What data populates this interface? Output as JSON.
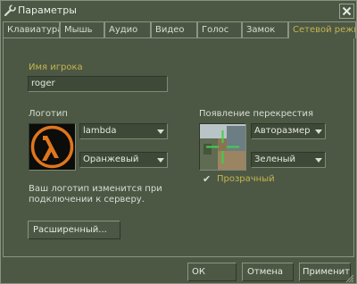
{
  "window": {
    "title": "Параметры",
    "close_glyph": "✕"
  },
  "tabs": [
    {
      "label": "Клавиатура",
      "active": false
    },
    {
      "label": "Мышь",
      "active": false
    },
    {
      "label": "Аудио",
      "active": false
    },
    {
      "label": "Видео",
      "active": false
    },
    {
      "label": "Голос",
      "active": false
    },
    {
      "label": "Замок",
      "active": false
    },
    {
      "label": "Сетевой режим",
      "active": true
    }
  ],
  "player": {
    "label": "Имя игрока",
    "value": "roger"
  },
  "logo": {
    "label": "Логотип",
    "name_value": "lambda",
    "color_value": "Оранжевый",
    "hint_line1": "Ваш логотип изменится при",
    "hint_line2": "подключении к серверу.",
    "icon": "lambda-logo-icon"
  },
  "crosshair": {
    "label": "Появление перекрестия",
    "size_value": "Авторазмер",
    "color_value": "Зеленый",
    "translucent_label": "Прозрачный",
    "translucent_checked": true,
    "check_glyph": "✔"
  },
  "buttons": {
    "advanced": "Расширенный...",
    "ok": "ОК",
    "cancel": "Отмена",
    "apply": "Применить"
  },
  "colors": {
    "background": "#4c5844",
    "accent": "#c4b550",
    "text": "#d8ded3",
    "logo_orange": "#e0761c",
    "crosshair_green": "#3fd04a"
  }
}
